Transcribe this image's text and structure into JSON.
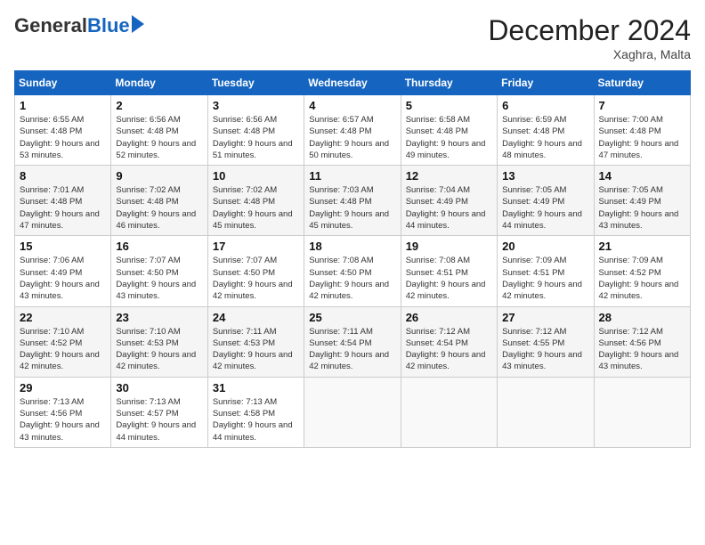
{
  "logo": {
    "general": "General",
    "blue": "Blue"
  },
  "title": "December 2024",
  "subtitle": "Xaghra, Malta",
  "days": [
    "Sunday",
    "Monday",
    "Tuesday",
    "Wednesday",
    "Thursday",
    "Friday",
    "Saturday"
  ],
  "weeks": [
    [
      {
        "date": "1",
        "sunrise": "Sunrise: 6:55 AM",
        "sunset": "Sunset: 4:48 PM",
        "daylight": "Daylight: 9 hours and 53 minutes."
      },
      {
        "date": "2",
        "sunrise": "Sunrise: 6:56 AM",
        "sunset": "Sunset: 4:48 PM",
        "daylight": "Daylight: 9 hours and 52 minutes."
      },
      {
        "date": "3",
        "sunrise": "Sunrise: 6:56 AM",
        "sunset": "Sunset: 4:48 PM",
        "daylight": "Daylight: 9 hours and 51 minutes."
      },
      {
        "date": "4",
        "sunrise": "Sunrise: 6:57 AM",
        "sunset": "Sunset: 4:48 PM",
        "daylight": "Daylight: 9 hours and 50 minutes."
      },
      {
        "date": "5",
        "sunrise": "Sunrise: 6:58 AM",
        "sunset": "Sunset: 4:48 PM",
        "daylight": "Daylight: 9 hours and 49 minutes."
      },
      {
        "date": "6",
        "sunrise": "Sunrise: 6:59 AM",
        "sunset": "Sunset: 4:48 PM",
        "daylight": "Daylight: 9 hours and 48 minutes."
      },
      {
        "date": "7",
        "sunrise": "Sunrise: 7:00 AM",
        "sunset": "Sunset: 4:48 PM",
        "daylight": "Daylight: 9 hours and 47 minutes."
      }
    ],
    [
      {
        "date": "8",
        "sunrise": "Sunrise: 7:01 AM",
        "sunset": "Sunset: 4:48 PM",
        "daylight": "Daylight: 9 hours and 47 minutes."
      },
      {
        "date": "9",
        "sunrise": "Sunrise: 7:02 AM",
        "sunset": "Sunset: 4:48 PM",
        "daylight": "Daylight: 9 hours and 46 minutes."
      },
      {
        "date": "10",
        "sunrise": "Sunrise: 7:02 AM",
        "sunset": "Sunset: 4:48 PM",
        "daylight": "Daylight: 9 hours and 45 minutes."
      },
      {
        "date": "11",
        "sunrise": "Sunrise: 7:03 AM",
        "sunset": "Sunset: 4:48 PM",
        "daylight": "Daylight: 9 hours and 45 minutes."
      },
      {
        "date": "12",
        "sunrise": "Sunrise: 7:04 AM",
        "sunset": "Sunset: 4:49 PM",
        "daylight": "Daylight: 9 hours and 44 minutes."
      },
      {
        "date": "13",
        "sunrise": "Sunrise: 7:05 AM",
        "sunset": "Sunset: 4:49 PM",
        "daylight": "Daylight: 9 hours and 44 minutes."
      },
      {
        "date": "14",
        "sunrise": "Sunrise: 7:05 AM",
        "sunset": "Sunset: 4:49 PM",
        "daylight": "Daylight: 9 hours and 43 minutes."
      }
    ],
    [
      {
        "date": "15",
        "sunrise": "Sunrise: 7:06 AM",
        "sunset": "Sunset: 4:49 PM",
        "daylight": "Daylight: 9 hours and 43 minutes."
      },
      {
        "date": "16",
        "sunrise": "Sunrise: 7:07 AM",
        "sunset": "Sunset: 4:50 PM",
        "daylight": "Daylight: 9 hours and 43 minutes."
      },
      {
        "date": "17",
        "sunrise": "Sunrise: 7:07 AM",
        "sunset": "Sunset: 4:50 PM",
        "daylight": "Daylight: 9 hours and 42 minutes."
      },
      {
        "date": "18",
        "sunrise": "Sunrise: 7:08 AM",
        "sunset": "Sunset: 4:50 PM",
        "daylight": "Daylight: 9 hours and 42 minutes."
      },
      {
        "date": "19",
        "sunrise": "Sunrise: 7:08 AM",
        "sunset": "Sunset: 4:51 PM",
        "daylight": "Daylight: 9 hours and 42 minutes."
      },
      {
        "date": "20",
        "sunrise": "Sunrise: 7:09 AM",
        "sunset": "Sunset: 4:51 PM",
        "daylight": "Daylight: 9 hours and 42 minutes."
      },
      {
        "date": "21",
        "sunrise": "Sunrise: 7:09 AM",
        "sunset": "Sunset: 4:52 PM",
        "daylight": "Daylight: 9 hours and 42 minutes."
      }
    ],
    [
      {
        "date": "22",
        "sunrise": "Sunrise: 7:10 AM",
        "sunset": "Sunset: 4:52 PM",
        "daylight": "Daylight: 9 hours and 42 minutes."
      },
      {
        "date": "23",
        "sunrise": "Sunrise: 7:10 AM",
        "sunset": "Sunset: 4:53 PM",
        "daylight": "Daylight: 9 hours and 42 minutes."
      },
      {
        "date": "24",
        "sunrise": "Sunrise: 7:11 AM",
        "sunset": "Sunset: 4:53 PM",
        "daylight": "Daylight: 9 hours and 42 minutes."
      },
      {
        "date": "25",
        "sunrise": "Sunrise: 7:11 AM",
        "sunset": "Sunset: 4:54 PM",
        "daylight": "Daylight: 9 hours and 42 minutes."
      },
      {
        "date": "26",
        "sunrise": "Sunrise: 7:12 AM",
        "sunset": "Sunset: 4:54 PM",
        "daylight": "Daylight: 9 hours and 42 minutes."
      },
      {
        "date": "27",
        "sunrise": "Sunrise: 7:12 AM",
        "sunset": "Sunset: 4:55 PM",
        "daylight": "Daylight: 9 hours and 43 minutes."
      },
      {
        "date": "28",
        "sunrise": "Sunrise: 7:12 AM",
        "sunset": "Sunset: 4:56 PM",
        "daylight": "Daylight: 9 hours and 43 minutes."
      }
    ],
    [
      {
        "date": "29",
        "sunrise": "Sunrise: 7:13 AM",
        "sunset": "Sunset: 4:56 PM",
        "daylight": "Daylight: 9 hours and 43 minutes."
      },
      {
        "date": "30",
        "sunrise": "Sunrise: 7:13 AM",
        "sunset": "Sunset: 4:57 PM",
        "daylight": "Daylight: 9 hours and 44 minutes."
      },
      {
        "date": "31",
        "sunrise": "Sunrise: 7:13 AM",
        "sunset": "Sunset: 4:58 PM",
        "daylight": "Daylight: 9 hours and 44 minutes."
      },
      null,
      null,
      null,
      null
    ]
  ]
}
